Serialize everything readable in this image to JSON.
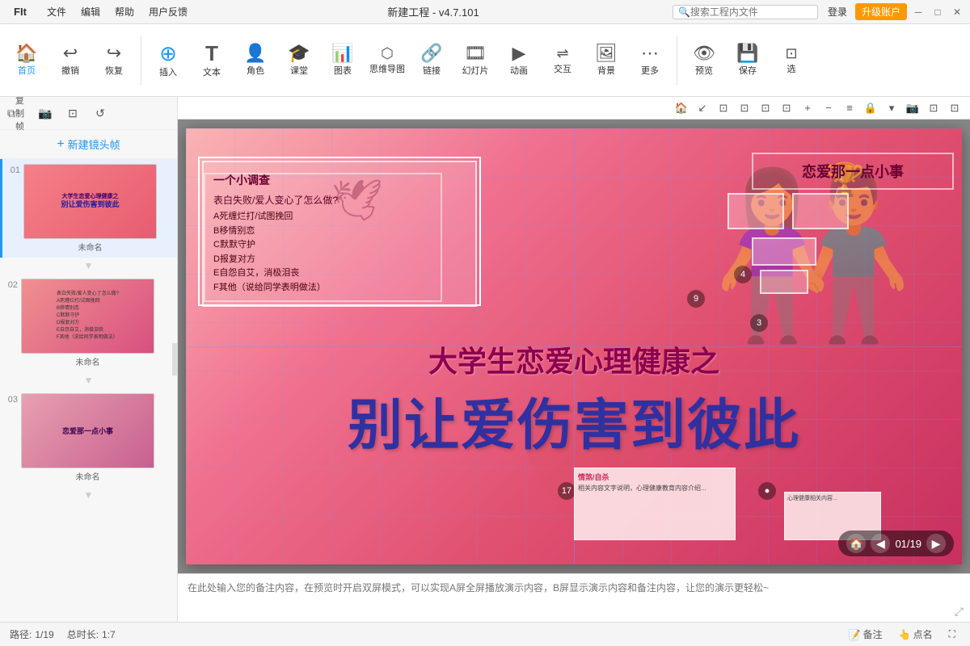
{
  "titlebar": {
    "logo": "FIt",
    "menus": [
      "文件",
      "编辑",
      "帮助",
      "用户反馈"
    ],
    "title": "新建工程 - v4.7.101",
    "search_placeholder": "搜索工程内文件",
    "login_label": "登录",
    "upgrade_label": "升级账户",
    "win_minimize": "─",
    "win_restore": "□",
    "win_close": "✕"
  },
  "toolbar": {
    "items": [
      {
        "id": "home",
        "icon": "🏠",
        "label": "首页"
      },
      {
        "id": "undo",
        "icon": "↩",
        "label": "撤销"
      },
      {
        "id": "redo",
        "icon": "↪",
        "label": "恢复"
      },
      {
        "id": "insert",
        "icon": "⊕",
        "label": "插入"
      },
      {
        "id": "text",
        "icon": "T",
        "label": "文本"
      },
      {
        "id": "role",
        "icon": "👤",
        "label": "角色"
      },
      {
        "id": "class",
        "icon": "🎓",
        "label": "课堂"
      },
      {
        "id": "chart",
        "icon": "📊",
        "label": "图表"
      },
      {
        "id": "mindmap",
        "icon": "🧠",
        "label": "思维导图"
      },
      {
        "id": "link",
        "icon": "🔗",
        "label": "链接"
      },
      {
        "id": "slideshow",
        "icon": "🎞",
        "label": "幻灯片"
      },
      {
        "id": "animation",
        "icon": "▶",
        "label": "动画"
      },
      {
        "id": "interact",
        "icon": "🖱",
        "label": "交互"
      },
      {
        "id": "background",
        "icon": "🖼",
        "label": "背景"
      },
      {
        "id": "more",
        "icon": "⋯",
        "label": "更多"
      },
      {
        "id": "preview",
        "icon": "👁",
        "label": "预览"
      },
      {
        "id": "save",
        "icon": "💾",
        "label": "保存"
      },
      {
        "id": "select",
        "icon": "⊡",
        "label": "选"
      }
    ]
  },
  "sidebar": {
    "tools": [
      "复制帧",
      "📷",
      "⊡",
      "↺"
    ],
    "new_frame_label": "新建镜头帧",
    "slides": [
      {
        "num": "01",
        "label": "未命名",
        "active": true,
        "thumb_type": "1"
      },
      {
        "num": "02",
        "label": "未命名",
        "active": false,
        "thumb_type": "2"
      },
      {
        "num": "03",
        "label": "未命名",
        "active": false,
        "thumb_type": "3"
      }
    ]
  },
  "canvas": {
    "toolbar_icons": [
      "🏠",
      "↙",
      "⊡",
      "⊡",
      "⊡",
      "⊡",
      "+",
      "−",
      "≡",
      "🔒",
      "▾",
      "📷",
      "⊡",
      "⊡"
    ],
    "slide": {
      "main_title_line1": "大学生恋爱心理健康之",
      "main_title_line2": "别让爱伤害到彼此",
      "survey_title": "一个小调查",
      "survey_question": "表白失败/爱人变心了怎么做?",
      "survey_options": [
        "A死缠烂打/试图挽回",
        "B移情别恋",
        "C默默守护",
        "D报复对方",
        "E自怨自艾，消极泪丧",
        "F其他（说给同学表明做法）"
      ],
      "love_title": "恋爱那一点小事"
    }
  },
  "notes": {
    "placeholder": "在此处输入您的备注内容，在预览时开启双屏模式，可以实现A屏全屏播放演示内容，B屏显示演示内容和备注内容，让您的演示更轻松~"
  },
  "statusbar": {
    "path_label": "路径:",
    "path_value": "1/19",
    "duration_label": "总时长:",
    "duration_value": "1:7",
    "annotation_label": "备注",
    "pointer_label": "点名",
    "slide_nav": "01/19"
  }
}
